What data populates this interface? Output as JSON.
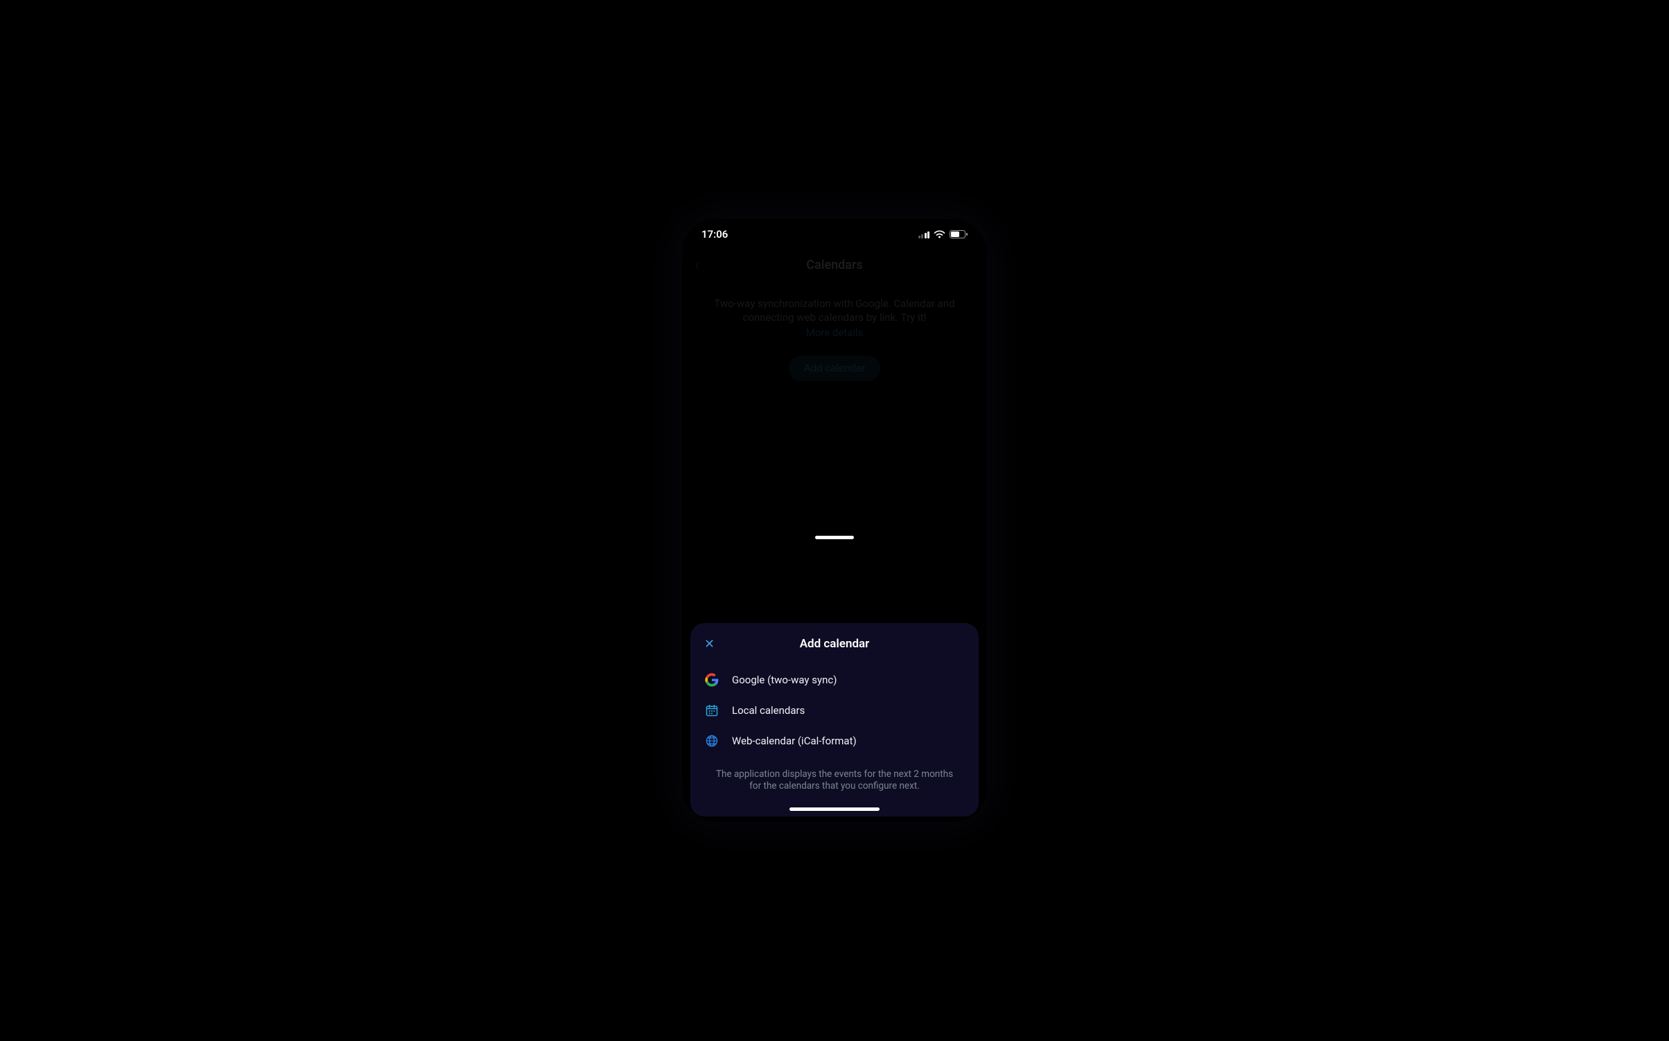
{
  "status": {
    "time": "17:06"
  },
  "nav": {
    "title": "Calendars"
  },
  "page": {
    "description": "Two-way synchronization with Google. Calendar and connecting web calendars by link. Try it!",
    "more_link": "More details",
    "add_button": "Add calendar"
  },
  "sheet": {
    "title": "Add calendar",
    "options": [
      {
        "label": "Google (two-way sync)"
      },
      {
        "label": "Local calendars"
      },
      {
        "label": "Web-calendar (iCal-format)"
      }
    ],
    "note": "The application displays the events for the next 2 months for the calendars that you configure next."
  }
}
